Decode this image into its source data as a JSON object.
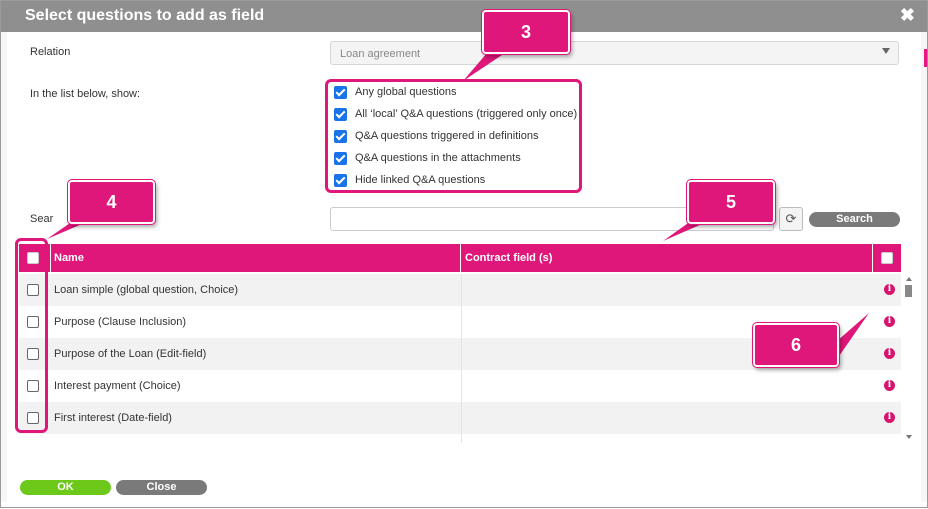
{
  "dialog": {
    "title": "Select questions to add as field",
    "close_glyph": "✖"
  },
  "form": {
    "relation_label": "Relation",
    "relation_value": "Loan agreement",
    "show_label": "In the list below, show:",
    "options": [
      {
        "label": "Any global questions",
        "checked": true
      },
      {
        "label": "All ‘local’ Q&A questions (triggered only once)",
        "checked": true
      },
      {
        "label": "Q&A questions triggered in definitions",
        "checked": true
      },
      {
        "label": "Q&A questions in the attachments",
        "checked": true
      },
      {
        "label": "Hide linked Q&A questions",
        "checked": true
      }
    ],
    "search_label": "Sear",
    "search_button": "Search",
    "refresh_glyph": "⟳"
  },
  "table": {
    "headers": {
      "name": "Name",
      "contract_field": "Contract field (s)"
    },
    "rows": [
      {
        "name": "Loan simple (global question, Choice)",
        "contract_field": ""
      },
      {
        "name": "Purpose (Clause Inclusion)",
        "contract_field": ""
      },
      {
        "name": "Purpose of the Loan (Edit-field)",
        "contract_field": ""
      },
      {
        "name": "Interest payment (Choice)",
        "contract_field": ""
      },
      {
        "name": "First interest (Date-field)",
        "contract_field": ""
      }
    ],
    "info_glyph": "i"
  },
  "callouts": [
    "3",
    "4",
    "5",
    "6"
  ],
  "footer": {
    "ok": "OK",
    "close": "Close"
  },
  "colors": {
    "accent": "#e0177a",
    "ok": "#6cc91a",
    "neutral_button": "#7a7a7a",
    "titlebar": "#8f8f8f"
  }
}
